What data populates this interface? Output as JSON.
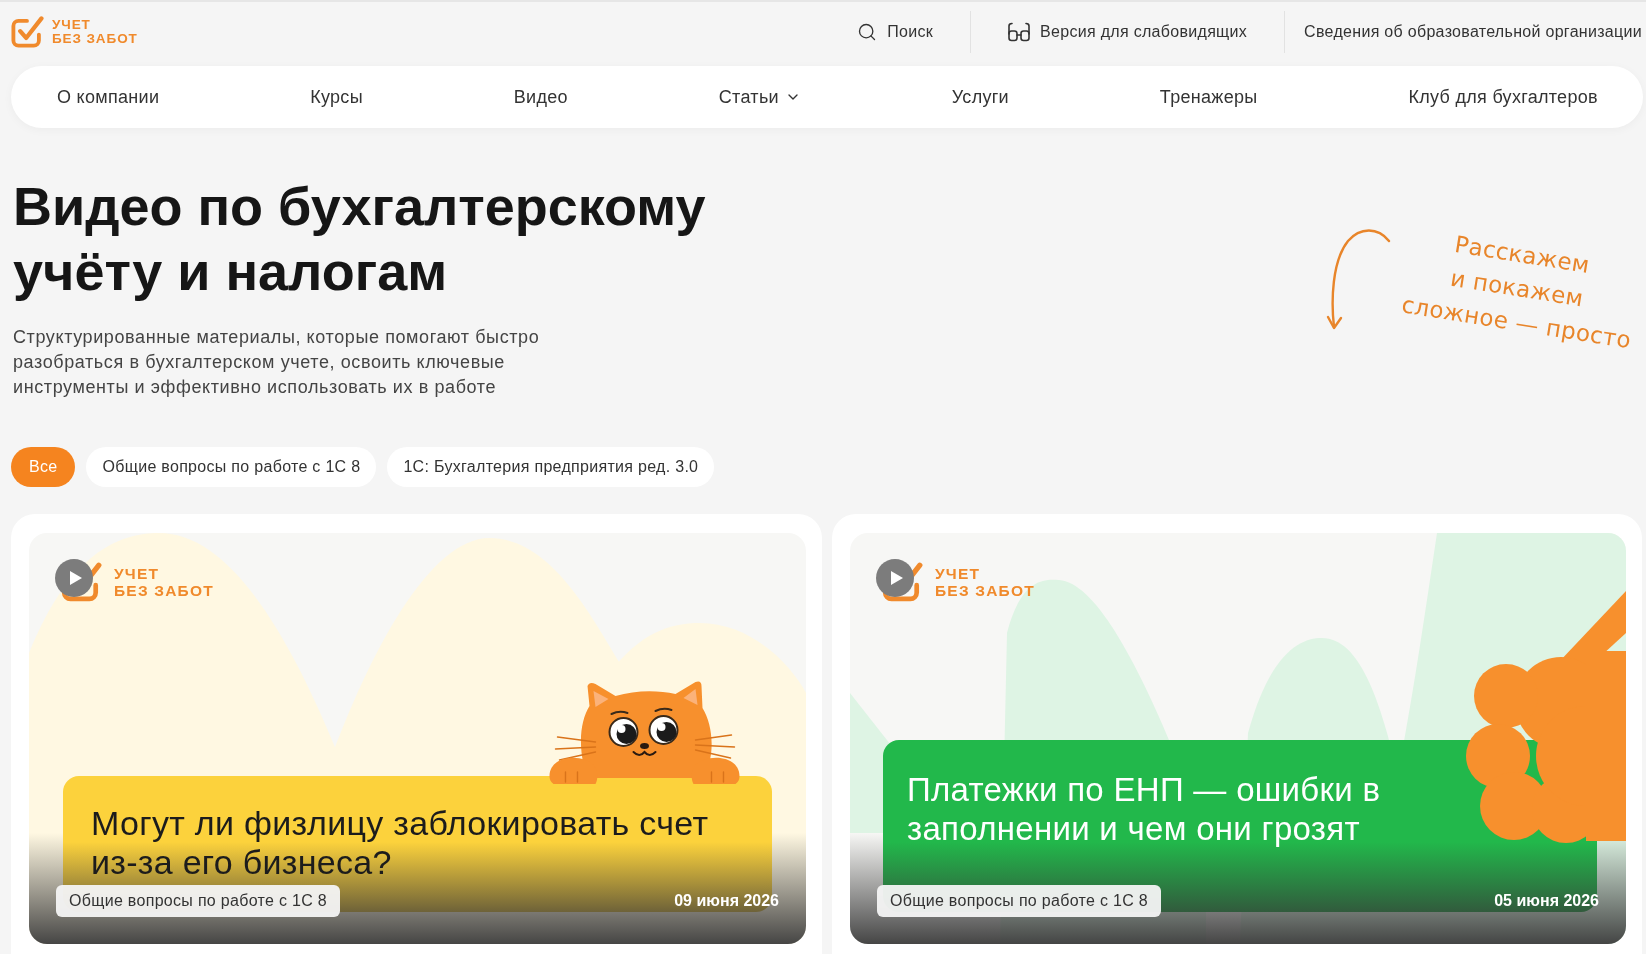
{
  "header": {
    "logo": [
      "УЧЕТ",
      "БЕЗ ЗАБОТ"
    ],
    "links": [
      {
        "kind": "search",
        "label": "Поиск"
      },
      {
        "kind": "low-vision",
        "label": "Версия для слабовидящих"
      },
      {
        "kind": "text",
        "label": "Сведения об образовательной организации"
      }
    ]
  },
  "nav": {
    "items": [
      {
        "label": "О компании",
        "dropdown": false
      },
      {
        "label": "Курсы",
        "dropdown": false
      },
      {
        "label": "Видео",
        "dropdown": false
      },
      {
        "label": "Статьи",
        "dropdown": true
      },
      {
        "label": "Услуги",
        "dropdown": false
      },
      {
        "label": "Тренажеры",
        "dropdown": false
      },
      {
        "label": "Клуб для бухгалтеров",
        "dropdown": false
      }
    ]
  },
  "hero": {
    "title": "Видео по бухгалтерскому учёту и налогам",
    "subtitle": "Структурированные материалы, которые помогают быстро разобраться в бухгалтерском учете, освоить ключевые инструменты и эффективно использовать их в работе",
    "note": [
      "Расскажем",
      "и покажем",
      "сложное — просто"
    ]
  },
  "filters": [
    {
      "label": "Все",
      "selected": true
    },
    {
      "label": "Общие вопросы по работе с 1С 8",
      "selected": false
    },
    {
      "label": "1С: Бухгалтерия предприятия ред. 3.0",
      "selected": false
    }
  ],
  "videos": [
    {
      "kind": "cat",
      "color": "#fcd23c",
      "logo": [
        "УЧЕТ",
        "БЕЗ ЗАБОТ"
      ],
      "title": "Могут ли физлицу заблокировать счет из-за его бизнеса?",
      "tag": "Общие вопросы по работе с 1С 8",
      "date": "09 июня 2026"
    },
    {
      "kind": "blob",
      "color": "#22b84b",
      "logo": [
        "УЧЕТ",
        "БЕЗ ЗАБОТ"
      ],
      "title": "Платежки по ЕНП — ошибки в заполнении и чем они грозят",
      "tag": "Общие вопросы по работе с 1С 8",
      "date": "05 июня 2026"
    }
  ]
}
